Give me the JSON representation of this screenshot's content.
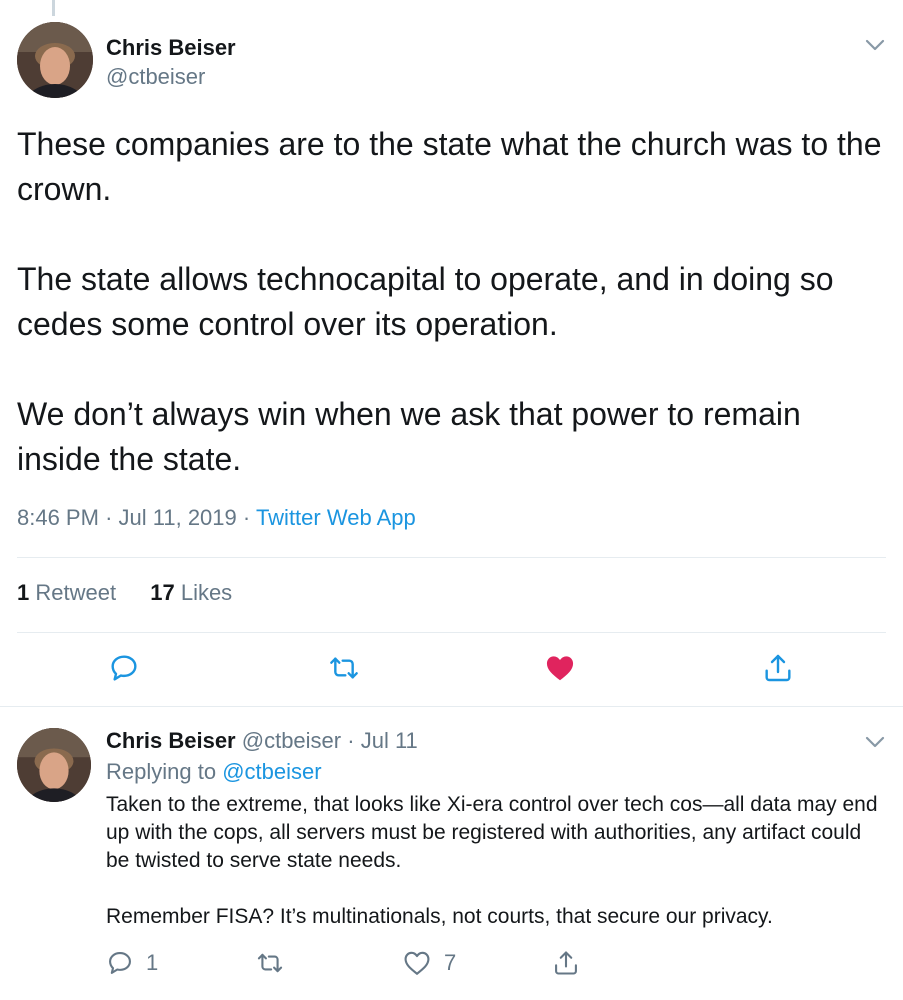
{
  "main_tweet": {
    "author": {
      "name": "Chris Beiser",
      "handle": "@ctbeiser"
    },
    "paragraphs": [
      "These companies are to the state what the church was to the crown.",
      "The state allows technocapital to operate, and in doing so cedes some control over its operation.",
      "We don’t always win when we ask that power to remain inside the state."
    ],
    "meta": {
      "time": "8:46 PM",
      "sep1": "·",
      "date": "Jul 11, 2019",
      "sep2": "·",
      "app": "Twitter Web App"
    },
    "stats": {
      "retweets_count": "1",
      "retweets_label": "Retweet",
      "likes_count": "17",
      "likes_label": "Likes"
    },
    "liked": true,
    "icons": [
      "reply-icon",
      "retweet-icon",
      "heart-filled-icon",
      "share-icon"
    ],
    "colors": {
      "like": "#e0245e",
      "link": "#1b95e0",
      "secondary": "#657786",
      "action": "#1b95e0"
    }
  },
  "reply_tweet": {
    "author": {
      "name": "Chris Beiser",
      "handle": "@ctbeiser"
    },
    "dot": "·",
    "date": "Jul 11",
    "replying_to_label": "Replying to",
    "replying_to_handle": "@ctbeiser",
    "paragraphs": [
      "Taken to the extreme, that looks like Xi-era control over tech cos—all data may end up with the cops, all servers must be registered with authorities, any artifact could be twisted to serve state needs.",
      "Remember FISA? It’s multinationals, not courts, that secure our privacy."
    ],
    "counts": {
      "replies": "1",
      "likes": "7"
    },
    "icons": [
      "reply-icon",
      "retweet-icon",
      "heart-outline-icon",
      "share-icon"
    ]
  }
}
